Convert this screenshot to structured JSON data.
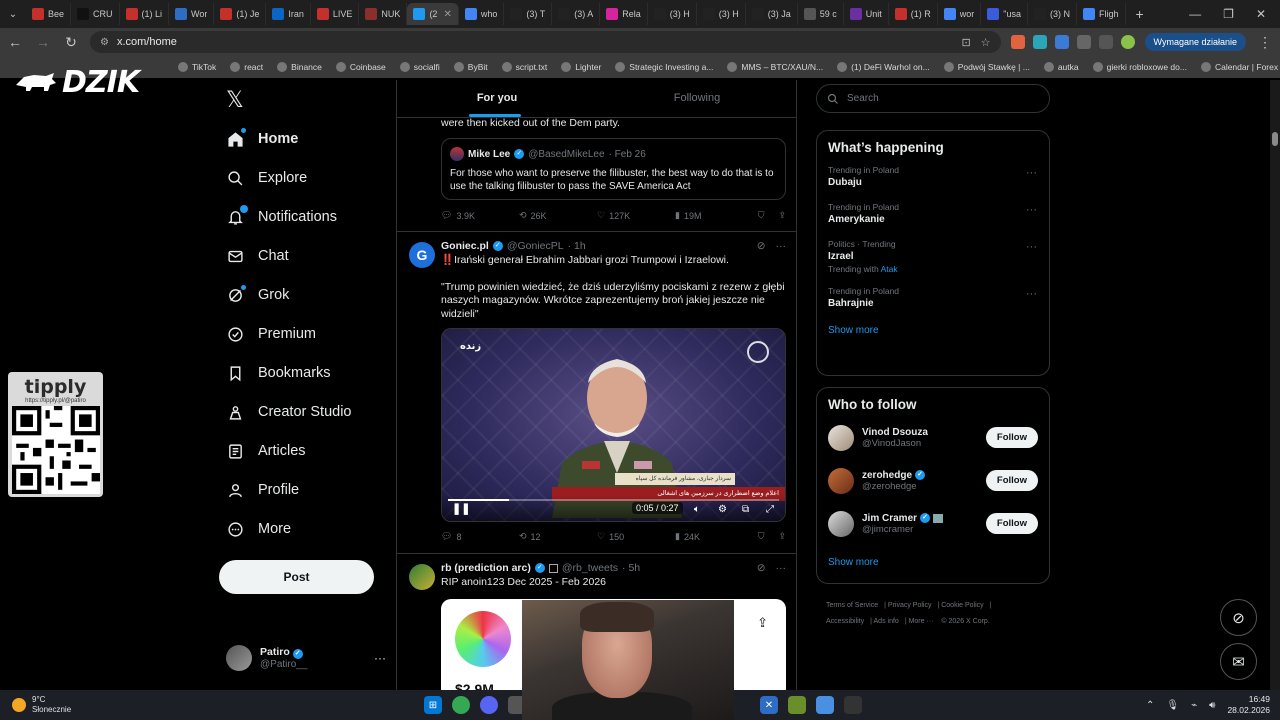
{
  "browser": {
    "tabs": [
      {
        "label": "Bee",
        "color": "#c4302b",
        "active": false
      },
      {
        "label": "CRU",
        "color": "#111111",
        "active": false
      },
      {
        "label": "(1) Li",
        "color": "#c4302b",
        "active": false
      },
      {
        "label": "Wor",
        "color": "#2f6cc4",
        "active": false
      },
      {
        "label": "(1) Je",
        "color": "#c4302b",
        "active": false
      },
      {
        "label": "Iran",
        "color": "#0a66c2",
        "active": false
      },
      {
        "label": "LIVE",
        "color": "#c4302b",
        "active": false
      },
      {
        "label": "NUK",
        "color": "#8b2e2e",
        "active": false
      },
      {
        "label": "(2",
        "color": "#1d9bf0",
        "active": true
      },
      {
        "label": "who",
        "color": "#4285f4",
        "active": false
      },
      {
        "label": "(3) T",
        "color": "#222222",
        "active": false
      },
      {
        "label": "(3) A",
        "color": "#222222",
        "active": false
      },
      {
        "label": "Rela",
        "color": "#d6249f",
        "active": false
      },
      {
        "label": "(3) H",
        "color": "#222222",
        "active": false
      },
      {
        "label": "(3) H",
        "color": "#222222",
        "active": false
      },
      {
        "label": "(3) Ja",
        "color": "#222222",
        "active": false
      },
      {
        "label": "59 c",
        "color": "#555555",
        "active": false
      },
      {
        "label": "Unit",
        "color": "#6b2fa3",
        "active": false
      },
      {
        "label": "(1) R",
        "color": "#c4302b",
        "active": false
      },
      {
        "label": "wor",
        "color": "#4285f4",
        "active": false
      },
      {
        "label": "\"usa",
        "color": "#3b5bdb",
        "active": false
      },
      {
        "label": "(3) N",
        "color": "#222222",
        "active": false
      },
      {
        "label": "Fligh",
        "color": "#4285f4",
        "active": false
      }
    ],
    "new_tab": "+",
    "window_controls": [
      "—",
      "❐",
      "✕"
    ],
    "url": "x.com/home",
    "action_button": "Wymagane działanie",
    "bookmarks": [
      "TikTok",
      "react",
      "Binance",
      "Coinbase",
      "socialfi",
      "ByBit",
      "script.txt",
      "Lighter",
      "Strategic Investing a...",
      "MMS – BTC/XAU/N...",
      "(1) DeFi Warhol on...",
      "Podwój Stawkę | ...",
      "autka",
      "gierki robloxowe do...",
      "Calendar | Forex Fac..."
    ],
    "bookmarks_more": "»"
  },
  "overlays": {
    "logo_text": "DZIK",
    "tipply_title": "tipply",
    "tipply_url": "https://tipply.pl/@patiro"
  },
  "nav": {
    "logo": "𝕏",
    "items": [
      {
        "label": "Home",
        "icon": "home-icon"
      },
      {
        "label": "Explore",
        "icon": "search-icon"
      },
      {
        "label": "Notifications",
        "icon": "bell-icon"
      },
      {
        "label": "Chat",
        "icon": "mail-icon"
      },
      {
        "label": "Grok",
        "icon": "grok-icon"
      },
      {
        "label": "Premium",
        "icon": "premium-icon"
      },
      {
        "label": "Bookmarks",
        "icon": "bookmark-icon"
      },
      {
        "label": "Creator Studio",
        "icon": "creator-studio-icon"
      },
      {
        "label": "Articles",
        "icon": "articles-icon"
      },
      {
        "label": "Profile",
        "icon": "profile-icon"
      },
      {
        "label": "More",
        "icon": "more-icon"
      }
    ],
    "post_label": "Post",
    "profile": {
      "name": "Patiro",
      "handle": "@Patiro__"
    }
  },
  "feed": {
    "tabs": [
      "For you",
      "Following"
    ],
    "post1": {
      "text_tail": "were then kicked out of the Dem party.",
      "quote": {
        "name": "Mike Lee",
        "handle": "@BasedMikeLee",
        "date": "· Feb 26",
        "text": "For those who want to preserve the filibuster, the best way to do that is to use the talking filibuster to pass the SAVE America Act"
      },
      "stats": {
        "replies": "3.9K",
        "reposts": "26K",
        "likes": "127K",
        "views": "19M"
      }
    },
    "post2": {
      "name": "Goniec.pl",
      "handle": "@GoniecPL",
      "time": "· 1h",
      "line1": "‼️Irański generał Ebrahim Jabbari grozi Trumpowi i Izraelowi.",
      "line2": "\"Trump powinien wiedzieć, że dziś uderzyliśmy pociskami z rezerw z głębi naszych magazynów. Wkrótce zaprezentujemy broń jakiej jeszcze nie widzieli\"",
      "video": {
        "time": "0:05 / 0:27",
        "progress": 0.185,
        "live_text": "زنده",
        "lower_third_1": "سردار جباری، مشاور فرمانده کل سپاه",
        "lower_third_2": "اعلام وضع اضطراری در سرزمین های اشغالی"
      },
      "stats": {
        "replies": "8",
        "reposts": "12",
        "likes": "150",
        "views": "24K"
      }
    },
    "post3": {
      "name": "rb (prediction arc)",
      "handle": "@rb_tweets",
      "time": "· 5h",
      "text": "RIP anoin123 Dec 2025 - Feb 2026",
      "card_price": "$2.9M"
    }
  },
  "sidebar": {
    "search_placeholder": "Search",
    "whats_happening": "What’s happening",
    "trends": [
      {
        "context": "Trending in Poland",
        "name": "Dubaju",
        "with": ""
      },
      {
        "context": "Trending in Poland",
        "name": "Amerykanie",
        "with": ""
      },
      {
        "context": "Politics · Trending",
        "name": "Izrael",
        "with": "Atak"
      },
      {
        "context": "Trending in Poland",
        "name": "Bahrajnie",
        "with": ""
      }
    ],
    "trending_with_label": "Trending with",
    "show_more": "Show more",
    "who_to_follow": "Who to follow",
    "follow_suggestions": [
      {
        "name": "Vinod Dsouza",
        "handle": "@VinodJason",
        "verified": false
      },
      {
        "name": "zerohedge",
        "handle": "@zerohedge",
        "verified": true
      },
      {
        "name": "Jim Cramer",
        "handle": "@jimcramer",
        "verified": true
      }
    ],
    "follow_label": "Follow",
    "footer": [
      "Terms of Service",
      "Privacy Policy",
      "Cookie Policy",
      "Accessibility",
      "Ads info",
      "More ···",
      "© 2026 X Corp."
    ]
  },
  "taskbar": {
    "temp": "9°C",
    "condition": "Słonecznie",
    "time": "16:49",
    "date": "28.02.2026"
  },
  "colors": {
    "accent": "#1d9bf0",
    "background": "#000000",
    "border": "#2f3336",
    "muted": "#71767b"
  }
}
